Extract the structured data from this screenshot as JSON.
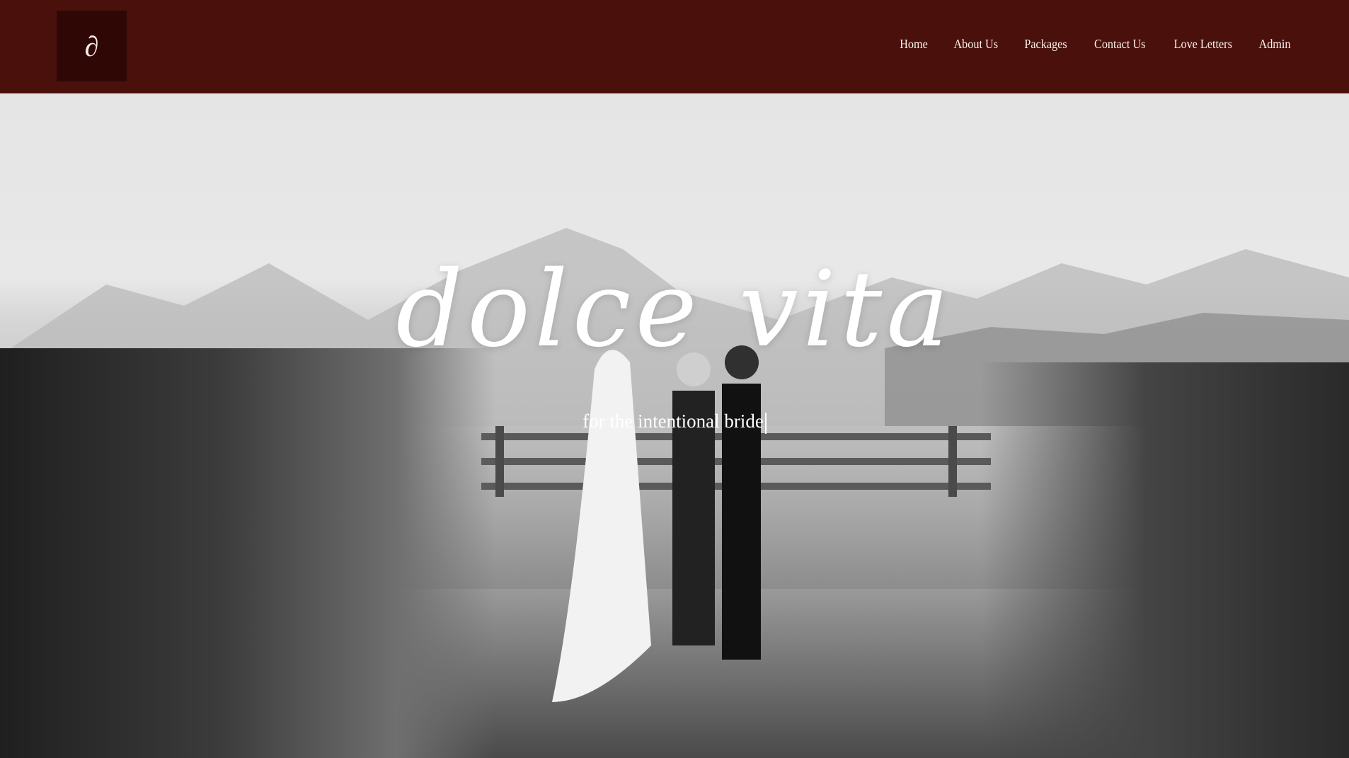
{
  "header": {
    "logo_glyph": "∂",
    "nav": [
      "Home",
      "About Us",
      "Packages",
      "Contact Us",
      "Love Letters",
      "Admin"
    ]
  },
  "hero": {
    "title": "dolce vita",
    "subtitle": "for the intentional bride"
  },
  "colors": {
    "header_bg": "#4a100c",
    "logo_bg": "#2f0806",
    "text": "#ffffff"
  }
}
